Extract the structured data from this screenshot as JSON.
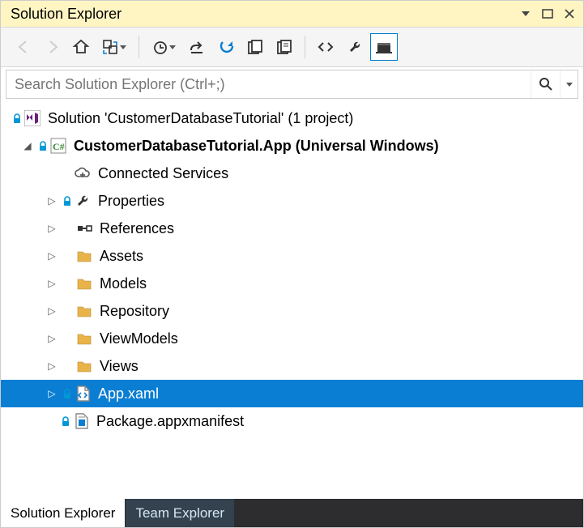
{
  "panel": {
    "title": "Solution Explorer"
  },
  "search": {
    "placeholder": "Search Solution Explorer (Ctrl+;)"
  },
  "tree": {
    "solution": "Solution 'CustomerDatabaseTutorial' (1 project)",
    "project": "CustomerDatabaseTutorial.App (Universal Windows)",
    "items": {
      "connectedServices": "Connected Services",
      "properties": "Properties",
      "references": "References",
      "assets": "Assets",
      "models": "Models",
      "repository": "Repository",
      "viewModels": "ViewModels",
      "views": "Views",
      "appXaml": "App.xaml",
      "manifest": "Package.appxmanifest"
    }
  },
  "tabs": {
    "solutionExplorer": "Solution Explorer",
    "teamExplorer": "Team Explorer"
  },
  "colors": {
    "selection": "#0a7ed3",
    "titlebar": "#fff5c2",
    "folder": "#e8b44a",
    "lock": "#0097d8"
  }
}
